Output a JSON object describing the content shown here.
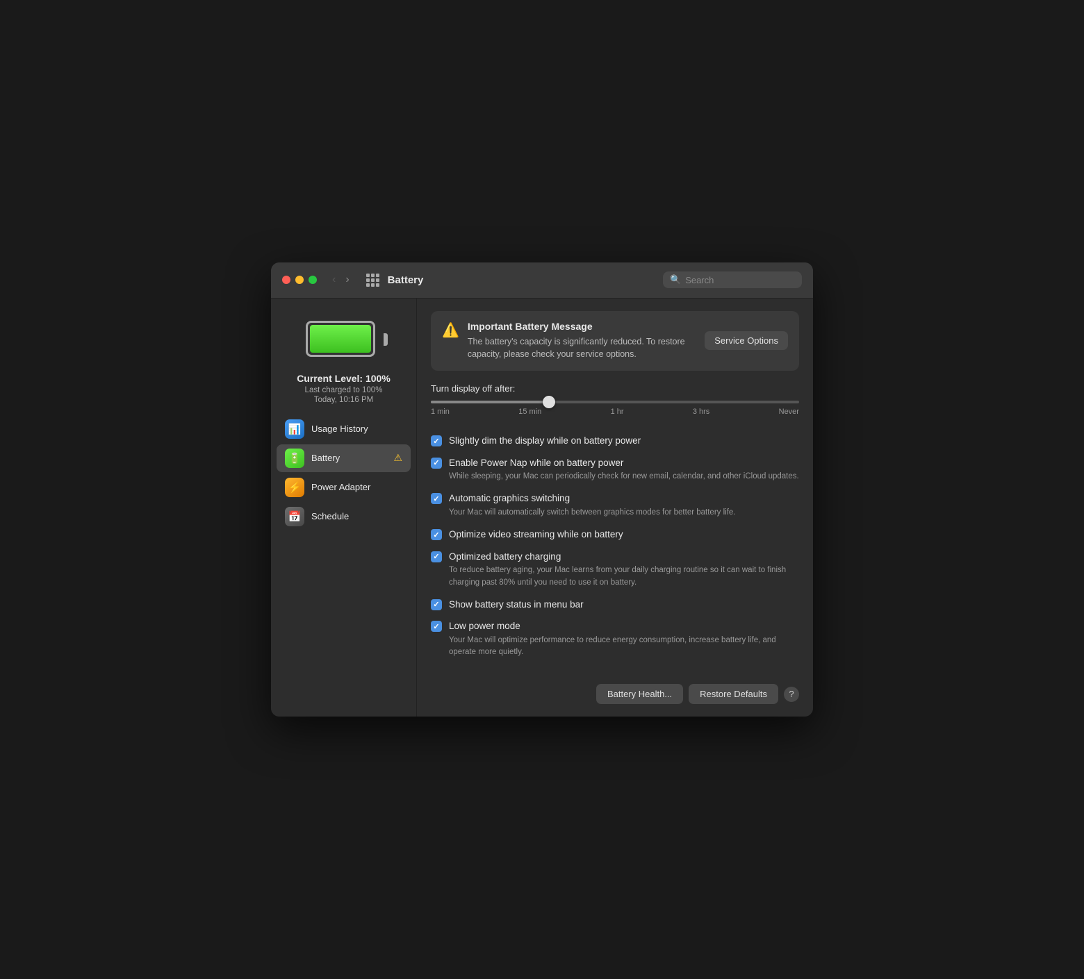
{
  "window": {
    "title": "Battery"
  },
  "titlebar": {
    "title": "Battery",
    "search_placeholder": "Search",
    "grid_icon_label": "App Grid"
  },
  "sidebar": {
    "battery_level": "Current Level: 100%",
    "last_charged": "Last charged to 100%",
    "time": "Today, 10:16 PM",
    "items": [
      {
        "id": "usage-history",
        "label": "Usage History",
        "icon": "📊",
        "icon_class": "icon-blue",
        "active": false,
        "warning": false
      },
      {
        "id": "battery",
        "label": "Battery",
        "icon": "🔋",
        "icon_class": "icon-green",
        "active": true,
        "warning": true
      },
      {
        "id": "power-adapter",
        "label": "Power Adapter",
        "icon": "⚡",
        "icon_class": "icon-orange",
        "active": false,
        "warning": false
      },
      {
        "id": "schedule",
        "label": "Schedule",
        "icon": "📅",
        "icon_class": "icon-gray",
        "active": false,
        "warning": false
      }
    ]
  },
  "alert": {
    "title": "Important Battery Message",
    "text": "The battery's capacity is significantly reduced. To restore capacity, please check your service options.",
    "service_button": "Service Options"
  },
  "slider": {
    "label": "Turn display off after:",
    "value_position": 32,
    "labels": [
      "1 min",
      "15 min",
      "1 hr",
      "3 hrs",
      "Never"
    ],
    "tick_count": 20
  },
  "options": [
    {
      "id": "dim-display",
      "title": "Slightly dim the display while on battery power",
      "description": "",
      "checked": true
    },
    {
      "id": "power-nap",
      "title": "Enable Power Nap while on battery power",
      "description": "While sleeping, your Mac can periodically check for new email, calendar, and other iCloud updates.",
      "checked": true
    },
    {
      "id": "auto-graphics",
      "title": "Automatic graphics switching",
      "description": "Your Mac will automatically switch between graphics modes for better battery life.",
      "checked": true
    },
    {
      "id": "video-streaming",
      "title": "Optimize video streaming while on battery",
      "description": "",
      "checked": true
    },
    {
      "id": "optimized-charging",
      "title": "Optimized battery charging",
      "description": "To reduce battery aging, your Mac learns from your daily charging routine so it can wait to finish charging past 80% until you need to use it on battery.",
      "checked": true
    },
    {
      "id": "menu-bar-status",
      "title": "Show battery status in menu bar",
      "description": "",
      "checked": true
    },
    {
      "id": "low-power-mode",
      "title": "Low power mode",
      "description": "Your Mac will optimize performance to reduce energy consumption, increase battery life, and operate more quietly.",
      "checked": true
    }
  ],
  "footer": {
    "battery_health_label": "Battery Health...",
    "restore_defaults_label": "Restore Defaults",
    "help_label": "?"
  }
}
